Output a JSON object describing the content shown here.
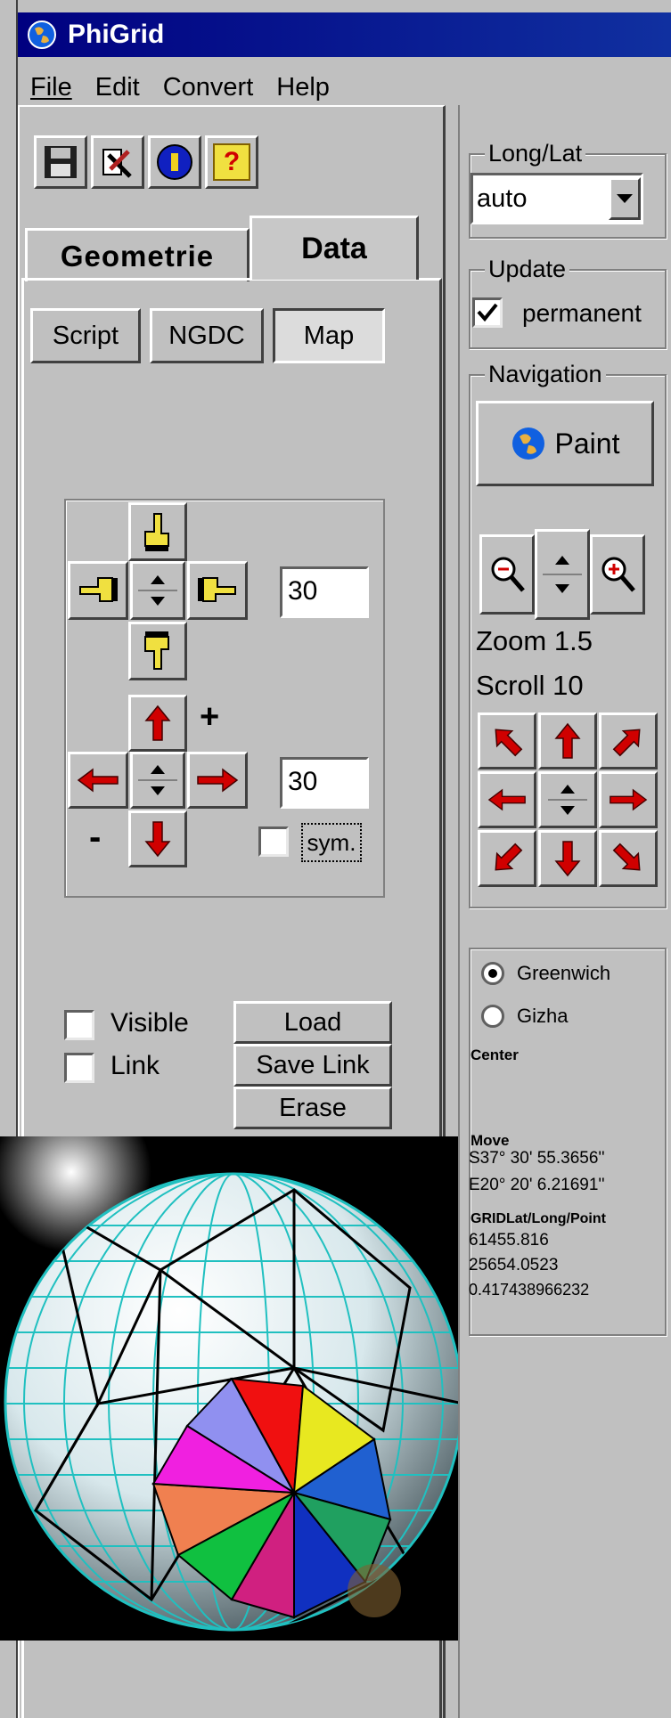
{
  "window": {
    "title": "PhiGrid",
    "app_icon": "globe-icon"
  },
  "menu": {
    "file": "File",
    "edit": "Edit",
    "convert": "Convert",
    "help": "Help"
  },
  "toolbar": {
    "icons": [
      "save-icon",
      "tools-icon",
      "info-icon",
      "help-icon"
    ],
    "help_glyph": "?",
    "info_glyph": "I"
  },
  "tabs": {
    "geometrie": "Geometrie",
    "data": "Data",
    "active": "Data"
  },
  "subtabs": {
    "script": "Script",
    "ngdc": "NGDC",
    "map": "Map"
  },
  "hand_pad": {
    "value": "30"
  },
  "arrow_pad": {
    "value": "30",
    "plus": "+",
    "minus": "-",
    "sym_label": "sym.",
    "sym_checked": false
  },
  "options": {
    "visible_label": "Visible",
    "visible_checked": false,
    "link_label": "Link",
    "link_checked": false
  },
  "actions": {
    "load": "Load",
    "save_link": "Save Link",
    "erase": "Erase"
  },
  "longlat": {
    "title": "Long/Lat",
    "value": "auto"
  },
  "update": {
    "title": "Update",
    "permanent_label": "permanent",
    "permanent_checked": true
  },
  "navigation": {
    "title": "Navigation",
    "paint_label": "Paint",
    "zoom_text": "Zoom 1.5",
    "scroll_text": "Scroll 10"
  },
  "info": {
    "greenwich": "Greenwich",
    "gizha": "Gizha",
    "selected": "Greenwich",
    "center_label": "Center",
    "move_label": "Move",
    "move_lat": "S37° 30' 55.3656''",
    "move_lon": "E20° 20' 6.21691''",
    "grid_label": "GRIDLat/Long/Point",
    "grid_lat": "61455.816",
    "grid_long": "25654.0523",
    "grid_point": "0.417438966232"
  },
  "colors": {
    "titlebar": "#000080",
    "face": "#c0c0c0",
    "arrow": "#d00000",
    "grid": "#20c0c0"
  }
}
